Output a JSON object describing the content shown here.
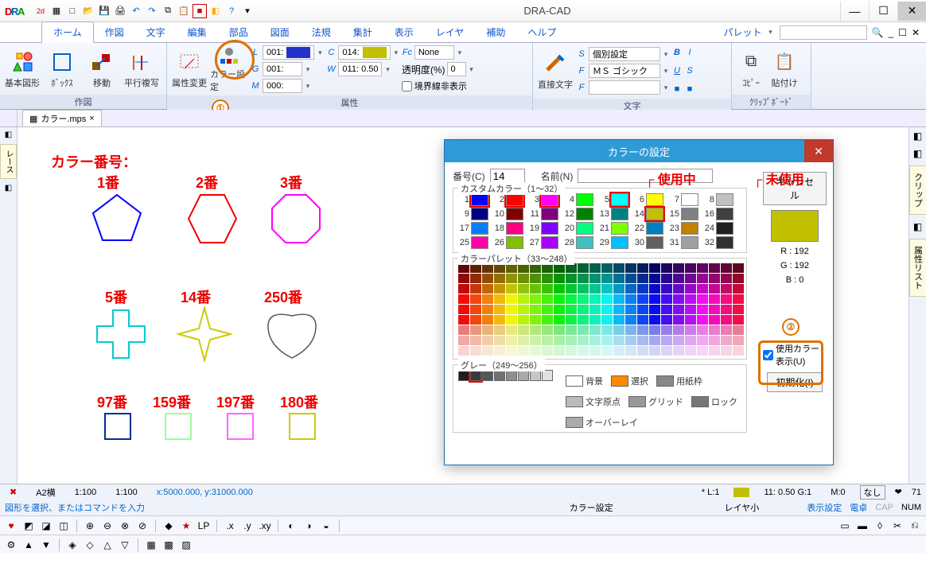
{
  "app": {
    "title": "DRA-CAD"
  },
  "qat_icons": [
    "2d3d",
    "grid",
    "new",
    "open",
    "save",
    "print",
    "undo",
    "redo",
    "copy",
    "paste",
    "screen",
    "color",
    "help",
    "dd"
  ],
  "ribbon": {
    "tabs": [
      "ホーム",
      "作図",
      "文字",
      "編集",
      "部品",
      "図面",
      "法規",
      "集計",
      "表示",
      "レイヤ",
      "補助",
      "ヘルプ"
    ],
    "active_tab": "ホーム",
    "palette_label": "パレット",
    "groups": {
      "sakuzu": {
        "title": "作図",
        "btns": [
          "基本図形",
          "ﾎﾞｯｸｽ",
          "移動",
          "平行複写"
        ]
      },
      "attr_btns": {
        "zokusei": "属性変更",
        "color": "カラー設定"
      },
      "attrs": {
        "title": "属性",
        "L_label": "L",
        "L_val": "001:",
        "L_color": "#2233cc",
        "C_label": "C",
        "C_val": "014:",
        "C_color": "#c0c000",
        "Fc_label": "Fc",
        "Fc_val": "None",
        "G_label": "G",
        "G_val": "001:",
        "W_label": "W",
        "W_val": "011: 0.50",
        "trans_label": "透明度(%)",
        "trans_val": "0",
        "M_label": "M",
        "M_val": "000:",
        "boundary_label": "境界線非表示"
      },
      "moji": {
        "title": "文字",
        "direct": "直接文字",
        "S_label": "S",
        "S_val": "個別設定",
        "F_label": "F",
        "F_val": "ＭＳ ゴシック",
        "P_label": "F",
        "P_val": ""
      },
      "clip": {
        "title": "ｸﾘｯﾌﾟﾎﾞｰﾄﾞ",
        "copy": "ｺﾋﾟｰ",
        "paste": "貼付け"
      }
    }
  },
  "doc_tab": {
    "name": "カラー.mps"
  },
  "side_tabs": {
    "left": "レース",
    "right": [
      "クリップ",
      "属性リスト"
    ]
  },
  "canvas": {
    "header": "カラー番号：",
    "labels": [
      "1番",
      "2番",
      "3番",
      "5番",
      "14番",
      "250番",
      "97番",
      "159番",
      "197番",
      "180番"
    ]
  },
  "dialog": {
    "title": "カラーの設定",
    "num_label": "番号(C)",
    "num_val": "14",
    "name_label": "名前(N)",
    "name_val": "",
    "custom_title": "カスタムカラー（1～32）",
    "palette_title": "カラーパレット（33～248）",
    "grey_title": "グレー（249～256）",
    "used_label": "使用中",
    "unused_label": "未使用",
    "cancel": "キャンセル",
    "preview_rgb": [
      "R : 192",
      "G : 192",
      "B : 0"
    ],
    "used_colors_label": "使用カラー表示(U)",
    "init_label": "初期化(I)",
    "specials": [
      "背景",
      "選択",
      "用紙枠",
      "文字原点",
      "グリッド",
      "ロック",
      "オーバーレイ"
    ],
    "custom_colors": [
      "#0000ff",
      "#ff0000",
      "#ff00ff",
      "#00ff00",
      "#00ffff",
      "#ffff00",
      "#ffffff",
      "#c0c0c0",
      "#000080",
      "#800000",
      "#800080",
      "#008000",
      "#008080",
      "#c0c000",
      "#808080",
      "#404040",
      "#0080ff",
      "#ff0080",
      "#8000ff",
      "#00ff80",
      "#80ff00",
      "#0080c0",
      "#c08000",
      "#202020",
      "#ff00aa",
      "#80c000",
      "#aa00ff",
      "#40c0c0",
      "#00c0ff",
      "#606060",
      "#a0a0a0",
      "#303030"
    ]
  },
  "annotations": {
    "num1": "①",
    "num2": "②"
  },
  "status": {
    "paper": "A2横",
    "scale": "1:100",
    "scale2": "1:100",
    "coords": "x:5000.000, y:31000.000",
    "layer": "*  L:1",
    "line": "11: 0.50  G:1",
    "mat": "M:0",
    "other": "なし",
    "count": "71",
    "prompt": "図形を選択、またはコマンドを入力",
    "cmd": "カラー設定",
    "layerscale": "レイヤ小",
    "disp": "表示設定",
    "calc": "電卓",
    "cap": "CAP",
    "num": "NUM"
  },
  "chart_data": {
    "type": "table",
    "title": "カスタムカラー（1～32）",
    "categories": [
      1,
      2,
      3,
      4,
      5,
      6,
      7,
      8,
      9,
      10,
      11,
      12,
      13,
      14,
      15,
      16,
      17,
      18,
      19,
      20,
      21,
      22,
      23,
      24,
      25,
      26,
      27,
      28,
      29,
      30,
      31,
      32
    ],
    "values": [
      "#0000ff",
      "#ff0000",
      "#ff00ff",
      "#00ff00",
      "#00ffff",
      "#ffff00",
      "#ffffff",
      "#c0c0c0",
      "#000080",
      "#800000",
      "#800080",
      "#008000",
      "#008080",
      "#c0c000",
      "#808080",
      "#404040",
      "#0080ff",
      "#ff0080",
      "#8000ff",
      "#00ff80",
      "#80ff00",
      "#0080c0",
      "#c08000",
      "#202020",
      "#ff00aa",
      "#80c000",
      "#aa00ff",
      "#40c0c0",
      "#00c0ff",
      "#606060",
      "#a0a0a0",
      "#303030"
    ]
  }
}
